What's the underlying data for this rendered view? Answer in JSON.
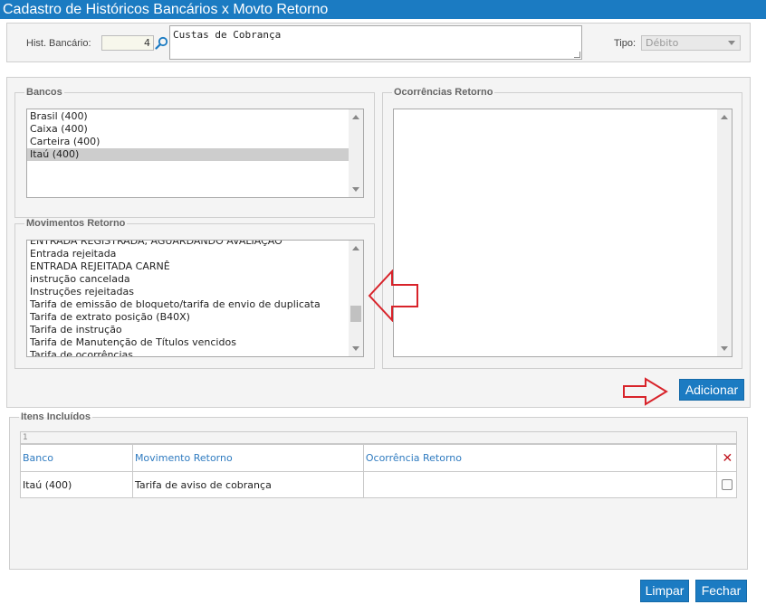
{
  "window": {
    "title": "Cadastro de Históricos Bancários x Movto Retorno"
  },
  "header": {
    "hist_label": "Hist. Bancário:",
    "hist_value": "4",
    "description": "Custas de Cobrança",
    "tipo_label": "Tipo:",
    "tipo_value": "Débito"
  },
  "bancos": {
    "legend": "Bancos",
    "items": [
      "Brasil (400)",
      "Caixa (400)",
      "Carteira (400)",
      "Itaú (400)"
    ],
    "selected": "Itaú (400)"
  },
  "movimentos": {
    "legend": "Movimentos Retorno",
    "items": [
      "ENTRADA REGISTRADA, AGUARDANDO AVALIAÇÃO",
      "Entrada rejeitada",
      "ENTRADA REJEITADA CARNÊ",
      "instrução cancelada",
      "Instruções rejeitadas",
      "Tarifa de emissão de bloqueto/tarifa de envio de duplicata",
      "Tarifa de extrato posição (B40X)",
      "Tarifa de instrução",
      "Tarifa de Manutenção de Títulos vencidos",
      "Tarifa de ocorrências"
    ]
  },
  "ocorrencias": {
    "legend": "Ocorrências Retorno",
    "items": []
  },
  "actions": {
    "adicionar": "Adicionar",
    "limpar": "Limpar",
    "fechar": "Fechar"
  },
  "itens": {
    "legend": "Itens Incluídos",
    "page": "1",
    "columns": [
      "Banco",
      "Movimento Retorno",
      "Ocorrência Retorno"
    ],
    "rows": [
      {
        "banco": "Itaú (400)",
        "movimento": "Tarifa de aviso de cobrança",
        "ocorrencia": ""
      }
    ]
  },
  "annotations": {
    "arrow_color": "#d8232a"
  }
}
